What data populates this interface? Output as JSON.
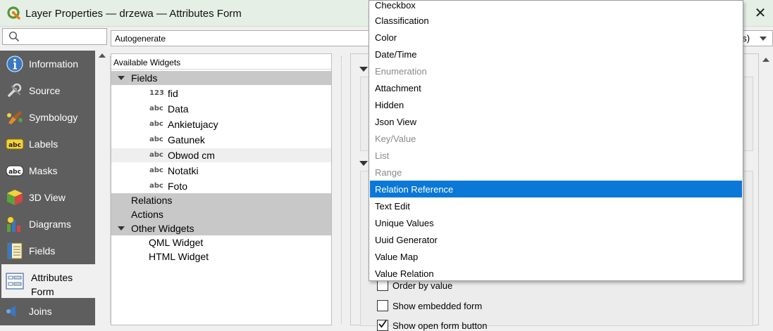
{
  "window": {
    "title": "Layer Properties — drzewa — Attributes Form",
    "close_glyph": "✕"
  },
  "search": {
    "placeholder": ""
  },
  "layout_combo": {
    "value": "Autogenerate",
    "tail": "gs)"
  },
  "sidebar": {
    "items": [
      {
        "label": "Information",
        "icon": "info-icon"
      },
      {
        "label": "Source",
        "icon": "wrench-icon"
      },
      {
        "label": "Symbology",
        "icon": "paintbrush-icon"
      },
      {
        "label": "Labels",
        "icon": "labels-abc-icon"
      },
      {
        "label": "Masks",
        "icon": "masks-abc-icon"
      },
      {
        "label": "3D View",
        "icon": "cube-icon"
      },
      {
        "label": "Diagrams",
        "icon": "diagram-icon"
      },
      {
        "label": "Fields",
        "icon": "fields-icon"
      },
      {
        "label_line1": "Attributes",
        "label_line2": "Form",
        "icon": "form-icon",
        "active": true
      },
      {
        "label": "Joins",
        "icon": "joins-icon"
      }
    ]
  },
  "tree": {
    "header": "Available Widgets",
    "fields_label": "Fields",
    "fields": [
      {
        "type": "123",
        "name": "fid"
      },
      {
        "type": "abc",
        "name": "Data"
      },
      {
        "type": "abc",
        "name": "Ankietujacy"
      },
      {
        "type": "abc",
        "name": "Gatunek"
      },
      {
        "type": "abc",
        "name": "Obwod cm"
      },
      {
        "type": "abc",
        "name": "Notatki"
      },
      {
        "type": "abc",
        "name": "Foto"
      }
    ],
    "relations_label": "Relations",
    "actions_label": "Actions",
    "other_label": "Other Widgets",
    "other": [
      "QML Widget",
      "HTML Widget"
    ]
  },
  "widget_dropdown": {
    "options": [
      {
        "label": "Checkbox",
        "enabled": true
      },
      {
        "label": "Classification",
        "enabled": true
      },
      {
        "label": "Color",
        "enabled": true
      },
      {
        "label": "Date/Time",
        "enabled": true
      },
      {
        "label": "Enumeration",
        "enabled": false
      },
      {
        "label": "Attachment",
        "enabled": true
      },
      {
        "label": "Hidden",
        "enabled": true
      },
      {
        "label": "Json View",
        "enabled": true
      },
      {
        "label": "Key/Value",
        "enabled": false
      },
      {
        "label": "List",
        "enabled": false
      },
      {
        "label": "Range",
        "enabled": false
      },
      {
        "label": "Relation Reference",
        "enabled": true,
        "selected": true
      },
      {
        "label": "Text Edit",
        "enabled": true
      },
      {
        "label": "Unique Values",
        "enabled": true
      },
      {
        "label": "Uuid Generator",
        "enabled": true
      },
      {
        "label": "Value Map",
        "enabled": true
      },
      {
        "label": "Value Relation",
        "enabled": true
      }
    ]
  },
  "options": {
    "order_by_value": "Order by value",
    "show_embedded_form": "Show embedded form",
    "show_open_form_button": "Show open form button"
  },
  "colors": {
    "selection": "#0a78d7",
    "sidebar": "#5e5e5e",
    "titlebar": "#e6efe6"
  }
}
